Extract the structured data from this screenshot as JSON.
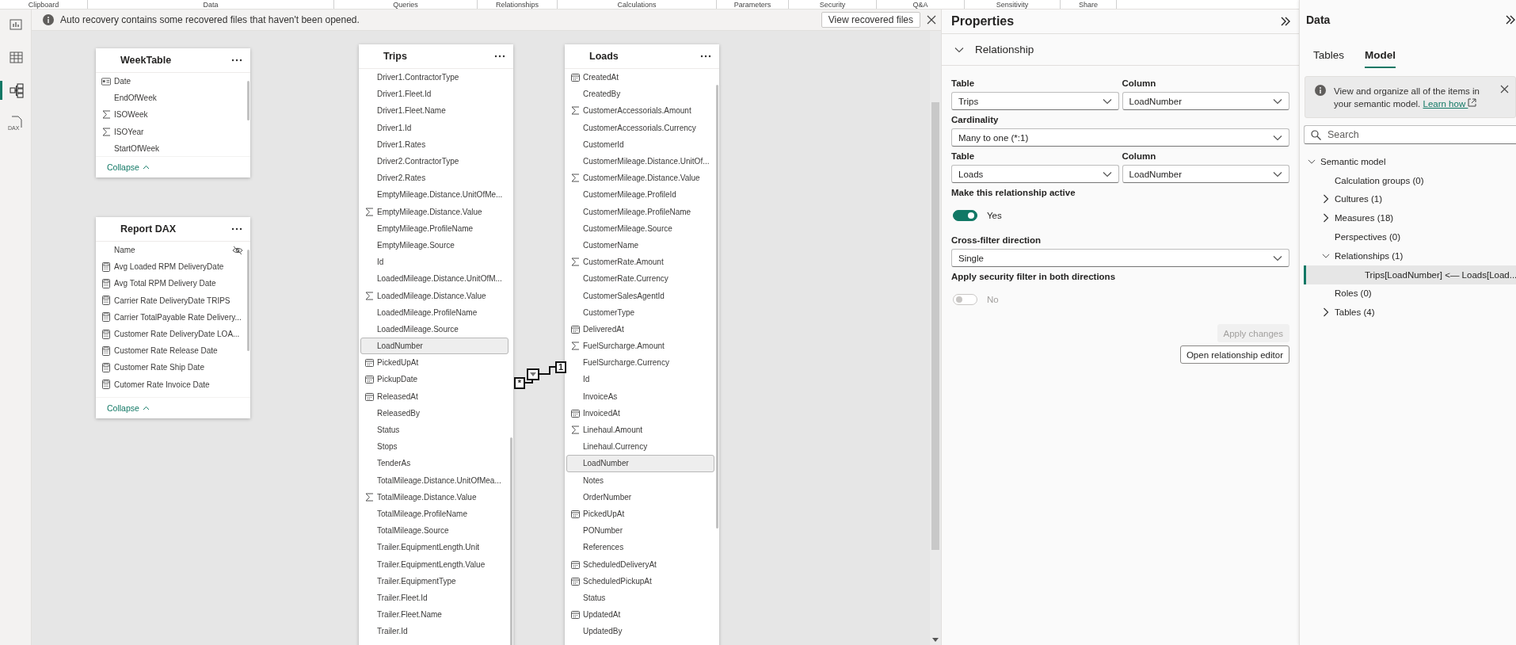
{
  "ribbon_groups": [
    "Clipboard",
    "Data",
    "Queries",
    "Relationships",
    "Calculations",
    "Parameters",
    "Security",
    "Q&A",
    "Sensitivity",
    "Share"
  ],
  "nav_rail": [
    {
      "kind": "report",
      "selected": false
    },
    {
      "kind": "table",
      "selected": false
    },
    {
      "kind": "model",
      "selected": true
    },
    {
      "kind": "dax",
      "label": "DAX",
      "selected": false
    }
  ],
  "notice": {
    "message": "Auto recovery contains some recovered files that haven't been opened.",
    "button": "View recovered files"
  },
  "tables": [
    {
      "name": "WeekTable",
      "footer": "Collapse",
      "fields": [
        {
          "name": "Date",
          "kind": "key",
          "selected": false
        },
        {
          "name": "EndOfWeek",
          "kind": "plain",
          "selected": false
        },
        {
          "name": "ISOWeek",
          "kind": "sum",
          "selected": false
        },
        {
          "name": "ISOYear",
          "kind": "sum",
          "selected": false
        },
        {
          "name": "StartOfWeek",
          "kind": "plain",
          "selected": false
        }
      ]
    },
    {
      "name": "Report DAX",
      "footer": "Collapse",
      "fields": [
        {
          "name": "Name",
          "kind": "hidden",
          "selected": false
        },
        {
          "name": "Avg Loaded RPM DeliveryDate",
          "kind": "measure",
          "selected": false
        },
        {
          "name": "Avg Total RPM Delivery Date",
          "kind": "measure",
          "selected": false
        },
        {
          "name": "Carrier Rate DeliveryDate TRIPS",
          "kind": "measure",
          "selected": false
        },
        {
          "name": "Carrier TotalPayable Rate Delivery...",
          "kind": "measure",
          "selected": false
        },
        {
          "name": "Customer Rate DeliveryDate LOA...",
          "kind": "measure",
          "selected": false
        },
        {
          "name": "Customer Rate Release Date",
          "kind": "measure",
          "selected": false
        },
        {
          "name": "Customer Rate Ship Date",
          "kind": "measure",
          "selected": false
        },
        {
          "name": "Cutomer Rate Invoice Date",
          "kind": "measure",
          "selected": false
        }
      ]
    },
    {
      "name": "Trips",
      "fields": [
        {
          "name": "Driver1.ContractorType",
          "kind": "plain",
          "selected": false
        },
        {
          "name": "Driver1.Fleet.Id",
          "kind": "plain",
          "selected": false
        },
        {
          "name": "Driver1.Fleet.Name",
          "kind": "plain",
          "selected": false
        },
        {
          "name": "Driver1.Id",
          "kind": "plain",
          "selected": false
        },
        {
          "name": "Driver1.Rates",
          "kind": "plain",
          "selected": false
        },
        {
          "name": "Driver2.ContractorType",
          "kind": "plain",
          "selected": false
        },
        {
          "name": "Driver2.Rates",
          "kind": "plain",
          "selected": false
        },
        {
          "name": "EmptyMileage.Distance.UnitOfMe...",
          "kind": "plain",
          "selected": false
        },
        {
          "name": "EmptyMileage.Distance.Value",
          "kind": "sum",
          "selected": false
        },
        {
          "name": "EmptyMileage.ProfileName",
          "kind": "plain",
          "selected": false
        },
        {
          "name": "EmptyMileage.Source",
          "kind": "plain",
          "selected": false
        },
        {
          "name": "Id",
          "kind": "plain",
          "selected": false
        },
        {
          "name": "LoadedMileage.Distance.UnitOfM...",
          "kind": "plain",
          "selected": false
        },
        {
          "name": "LoadedMileage.Distance.Value",
          "kind": "sum",
          "selected": false
        },
        {
          "name": "LoadedMileage.ProfileName",
          "kind": "plain",
          "selected": false
        },
        {
          "name": "LoadedMileage.Source",
          "kind": "plain",
          "selected": false
        },
        {
          "name": "LoadNumber",
          "kind": "plain",
          "selected": true
        },
        {
          "name": "PickedUpAt",
          "kind": "date",
          "selected": false
        },
        {
          "name": "PickupDate",
          "kind": "date",
          "selected": false
        },
        {
          "name": "ReleasedAt",
          "kind": "date",
          "selected": false
        },
        {
          "name": "ReleasedBy",
          "kind": "plain",
          "selected": false
        },
        {
          "name": "Status",
          "kind": "plain",
          "selected": false
        },
        {
          "name": "Stops",
          "kind": "plain",
          "selected": false
        },
        {
          "name": "TenderAs",
          "kind": "plain",
          "selected": false
        },
        {
          "name": "TotalMileage.Distance.UnitOfMea...",
          "kind": "plain",
          "selected": false
        },
        {
          "name": "TotalMileage.Distance.Value",
          "kind": "sum",
          "selected": false
        },
        {
          "name": "TotalMileage.ProfileName",
          "kind": "plain",
          "selected": false
        },
        {
          "name": "TotalMileage.Source",
          "kind": "plain",
          "selected": false
        },
        {
          "name": "Trailer.EquipmentLength.Unit",
          "kind": "plain",
          "selected": false
        },
        {
          "name": "Trailer.EquipmentLength.Value",
          "kind": "plain",
          "selected": false
        },
        {
          "name": "Trailer.EquipmentType",
          "kind": "plain",
          "selected": false
        },
        {
          "name": "Trailer.Fleet.Id",
          "kind": "plain",
          "selected": false
        },
        {
          "name": "Trailer.Fleet.Name",
          "kind": "plain",
          "selected": false
        },
        {
          "name": "Trailer.Id",
          "kind": "plain",
          "selected": false
        }
      ]
    },
    {
      "name": "Loads",
      "fields": [
        {
          "name": "CreatedAt",
          "kind": "date",
          "selected": false
        },
        {
          "name": "CreatedBy",
          "kind": "plain",
          "selected": false
        },
        {
          "name": "CustomerAccessorials.Amount",
          "kind": "sum",
          "selected": false
        },
        {
          "name": "CustomerAccessorials.Currency",
          "kind": "plain",
          "selected": false
        },
        {
          "name": "CustomerId",
          "kind": "plain",
          "selected": false
        },
        {
          "name": "CustomerMileage.Distance.UnitOf...",
          "kind": "plain",
          "selected": false
        },
        {
          "name": "CustomerMileage.Distance.Value",
          "kind": "sum",
          "selected": false
        },
        {
          "name": "CustomerMileage.ProfileId",
          "kind": "plain",
          "selected": false
        },
        {
          "name": "CustomerMileage.ProfileName",
          "kind": "plain",
          "selected": false
        },
        {
          "name": "CustomerMileage.Source",
          "kind": "plain",
          "selected": false
        },
        {
          "name": "CustomerName",
          "kind": "plain",
          "selected": false
        },
        {
          "name": "CustomerRate.Amount",
          "kind": "sum",
          "selected": false
        },
        {
          "name": "CustomerRate.Currency",
          "kind": "plain",
          "selected": false
        },
        {
          "name": "CustomerSalesAgentId",
          "kind": "plain",
          "selected": false
        },
        {
          "name": "CustomerType",
          "kind": "plain",
          "selected": false
        },
        {
          "name": "DeliveredAt",
          "kind": "date",
          "selected": false
        },
        {
          "name": "FuelSurcharge.Amount",
          "kind": "sum",
          "selected": false
        },
        {
          "name": "FuelSurcharge.Currency",
          "kind": "plain",
          "selected": false
        },
        {
          "name": "Id",
          "kind": "plain",
          "selected": false
        },
        {
          "name": "InvoiceAs",
          "kind": "plain",
          "selected": false
        },
        {
          "name": "InvoicedAt",
          "kind": "date",
          "selected": false
        },
        {
          "name": "Linehaul.Amount",
          "kind": "sum",
          "selected": false
        },
        {
          "name": "Linehaul.Currency",
          "kind": "plain",
          "selected": false
        },
        {
          "name": "LoadNumber",
          "kind": "plain",
          "selected": true
        },
        {
          "name": "Notes",
          "kind": "plain",
          "selected": false
        },
        {
          "name": "OrderNumber",
          "kind": "plain",
          "selected": false
        },
        {
          "name": "PickedUpAt",
          "kind": "date",
          "selected": false
        },
        {
          "name": "PONumber",
          "kind": "plain",
          "selected": false
        },
        {
          "name": "References",
          "kind": "plain",
          "selected": false
        },
        {
          "name": "ScheduledDeliveryAt",
          "kind": "date",
          "selected": false
        },
        {
          "name": "ScheduledPickupAt",
          "kind": "date",
          "selected": false
        },
        {
          "name": "Status",
          "kind": "plain",
          "selected": false
        },
        {
          "name": "UpdatedAt",
          "kind": "date",
          "selected": false
        },
        {
          "name": "UpdatedBy",
          "kind": "plain",
          "selected": false
        }
      ]
    }
  ],
  "relationship": {
    "from_mark": "*",
    "to_mark": "1"
  },
  "properties": {
    "title": "Properties",
    "section": {
      "title": "Relationship",
      "expanded": true
    },
    "from_table": {
      "label": "Table",
      "value": "Trips"
    },
    "from_column": {
      "label": "Column",
      "value": "LoadNumber"
    },
    "cardinality": {
      "label": "Cardinality",
      "value": "Many to one (*:1)"
    },
    "to_table": {
      "label": "Table",
      "value": "Loads"
    },
    "to_column": {
      "label": "Column",
      "value": "LoadNumber"
    },
    "active": {
      "label": "Make this relationship active",
      "on": true,
      "state_text": "Yes",
      "disabled": false
    },
    "cross_filter": {
      "label": "Cross-filter direction",
      "value": "Single"
    },
    "security_filter": {
      "label": "Apply security filter in both directions",
      "on": false,
      "state_text": "No",
      "disabled": true
    },
    "buttons": [
      {
        "label": "Apply changes",
        "disabled": true
      },
      {
        "label": "Open relationship editor",
        "disabled": false
      }
    ]
  },
  "data_pane": {
    "title": "Data",
    "tabs": [
      {
        "label": "Tables",
        "selected": false
      },
      {
        "label": "Model",
        "selected": true
      }
    ],
    "info": {
      "text": "View and organize all of the items in your semantic model.",
      "link": "Learn how"
    },
    "search": {
      "placeholder": "Search"
    },
    "tree": [
      {
        "label": "Semantic model",
        "expanded": true,
        "selected": false,
        "children": [
          {
            "label": "Calculation groups (0)",
            "selected": false
          },
          {
            "label": "Cultures (1)",
            "expanded": false,
            "selected": false
          },
          {
            "label": "Measures (18)",
            "expanded": false,
            "selected": false
          },
          {
            "label": "Perspectives (0)",
            "selected": false
          },
          {
            "label": "Relationships (1)",
            "expanded": true,
            "selected": false,
            "children": [
              {
                "label": "Trips[LoadNumber] <— Loads[Load...",
                "kind": "relationship",
                "selected": true
              }
            ]
          },
          {
            "label": "Roles (0)",
            "selected": false
          },
          {
            "label": "Tables (4)",
            "expanded": false,
            "selected": false
          }
        ]
      }
    ]
  }
}
